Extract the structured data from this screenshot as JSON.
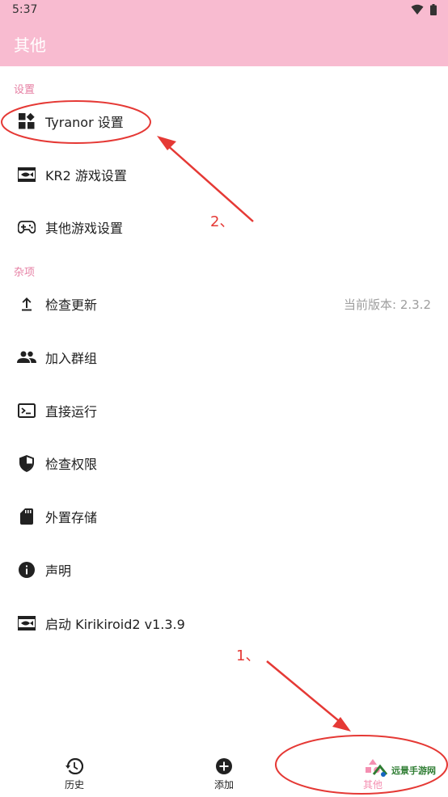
{
  "status_bar": {
    "time": "5:37"
  },
  "app_bar": {
    "title": "其他"
  },
  "sections": {
    "settings_header": "设置",
    "misc_header": "杂项"
  },
  "settings_items": [
    {
      "label": "Tyranor 设置",
      "icon": "widgets-icon"
    },
    {
      "label": "KR2 游戏设置",
      "icon": "kirikiri-icon"
    },
    {
      "label": "其他游戏设置",
      "icon": "gamepad-icon"
    }
  ],
  "misc_items": [
    {
      "label": "检查更新",
      "icon": "upload-icon",
      "summary": "当前版本: 2.3.2"
    },
    {
      "label": "加入群组",
      "icon": "group-icon"
    },
    {
      "label": "直接运行",
      "icon": "terminal-icon"
    },
    {
      "label": "检查权限",
      "icon": "shield-icon"
    },
    {
      "label": "外置存储",
      "icon": "sd-card-icon"
    },
    {
      "label": "声明",
      "icon": "info-icon"
    },
    {
      "label": "启动 Kirikiroid2 v1.3.9",
      "icon": "kirikiri-icon"
    }
  ],
  "bottom_nav": [
    {
      "label": "历史",
      "icon": "history-icon"
    },
    {
      "label": "添加",
      "icon": "add-circle-icon"
    },
    {
      "label": "其他",
      "icon": "other-icon"
    }
  ],
  "annotations": {
    "step1": "1、",
    "step2": "2、",
    "color": "#e53935"
  },
  "watermark": {
    "text": "远景手游网"
  },
  "colors": {
    "accent": "#f8bbd0",
    "section_header": "#e67fa3",
    "summary": "#9e9e9e"
  }
}
